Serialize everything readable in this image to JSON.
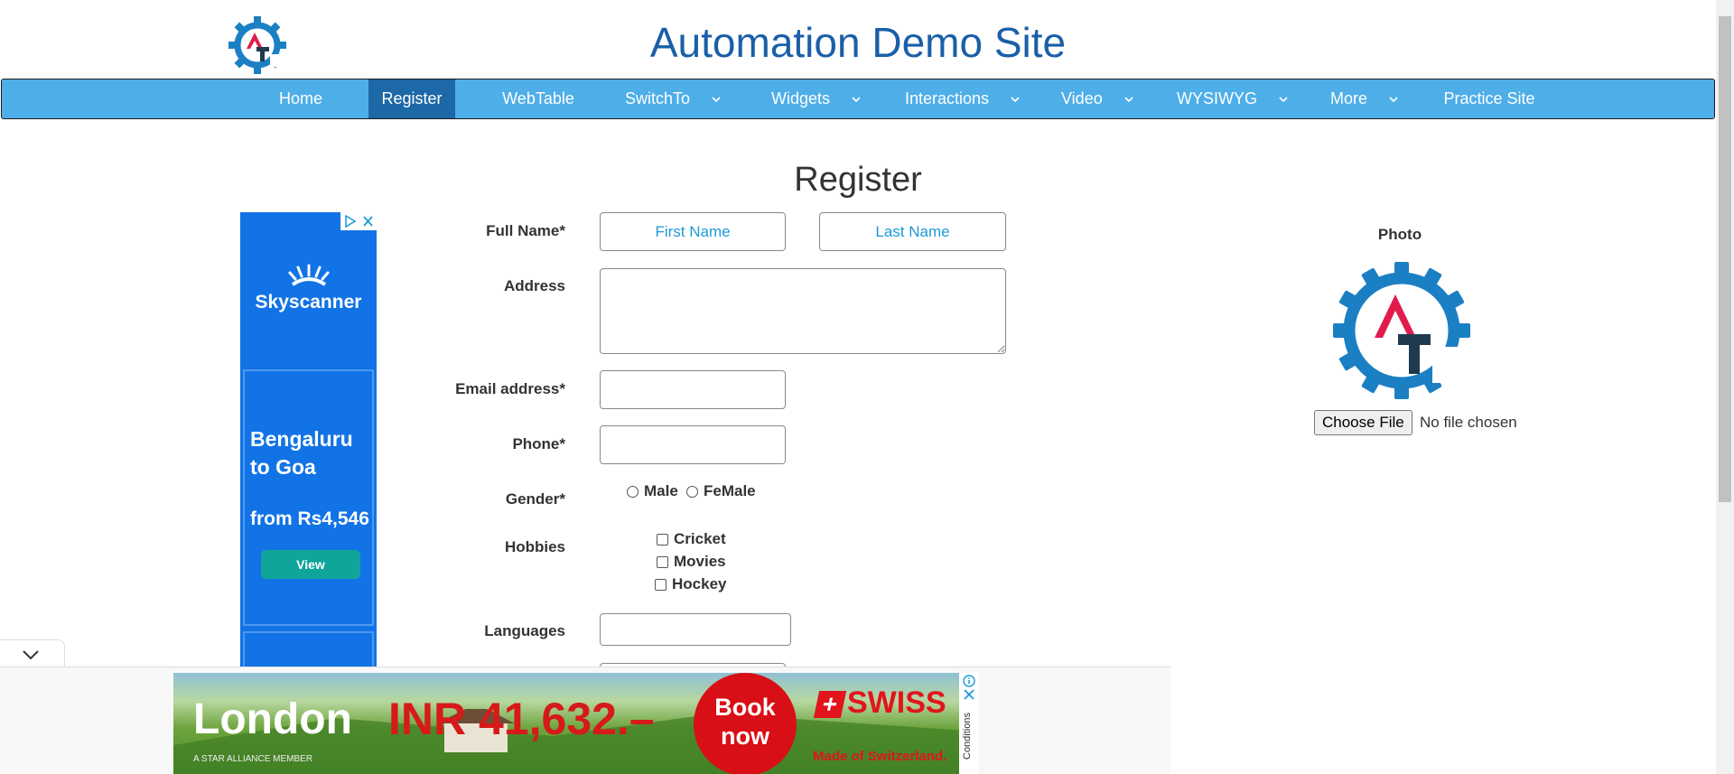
{
  "header": {
    "title": "Automation Demo Site"
  },
  "nav": {
    "items": [
      {
        "label": "Home"
      },
      {
        "label": "Register"
      },
      {
        "label": "WebTable"
      },
      {
        "label": "SwitchTo"
      },
      {
        "label": "Widgets"
      },
      {
        "label": "Interactions"
      },
      {
        "label": "Video"
      },
      {
        "label": "WYSIWYG"
      },
      {
        "label": "More"
      },
      {
        "label": "Practice Site"
      }
    ],
    "active": "Register",
    "colors": {
      "bar": "#4eaee8",
      "active": "#1d68a7"
    }
  },
  "page": {
    "title": "Register"
  },
  "form": {
    "full_name_label": "Full Name*",
    "first_name_placeholder": "First Name",
    "last_name_placeholder": "Last Name",
    "address_label": "Address",
    "email_label": "Email address*",
    "phone_label": "Phone*",
    "gender_label": "Gender*",
    "gender_options": [
      "Male",
      "FeMale"
    ],
    "hobbies_label": "Hobbies",
    "hobbies": [
      "Cricket",
      "Movies",
      "Hockey"
    ],
    "languages_label": "Languages"
  },
  "photo": {
    "label": "Photo",
    "button_label": "Choose File",
    "status": "No file chosen"
  },
  "ad_left": {
    "brand": "Skyscanner",
    "route": "Bengaluru to Goa",
    "price": "from Rs4,546",
    "cta": "View"
  },
  "ad_bottom": {
    "city": "London",
    "price": "INR 41,632.–",
    "cta_line1": "Book",
    "cta_line2": "now",
    "brand": "SWISS",
    "tagline": "Made of Switzerland.",
    "small_print": "A STAR ALLIANCE MEMBER",
    "side_label": "Conditions"
  }
}
